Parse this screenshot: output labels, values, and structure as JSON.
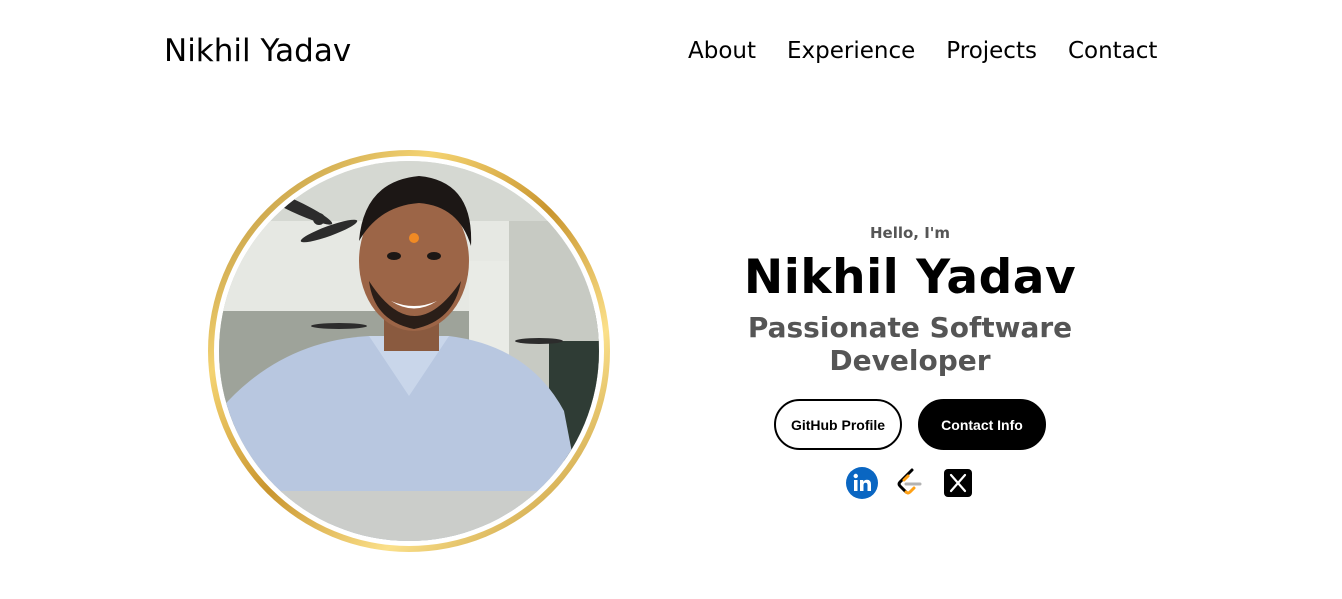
{
  "header": {
    "logo": "Nikhil Yadav",
    "nav": [
      {
        "label": "About"
      },
      {
        "label": "Experience"
      },
      {
        "label": "Projects"
      },
      {
        "label": "Contact"
      }
    ]
  },
  "hero": {
    "greeting": "Hello, I'm",
    "name": "Nikhil Yadav",
    "title": "Passionate Software Developer",
    "buttons": {
      "github": "GitHub Profile",
      "contact": "Contact Info"
    },
    "social_icons": [
      "linkedin-icon",
      "leetcode-icon",
      "x-twitter-icon"
    ]
  },
  "colors": {
    "accent_gold": "#d4a43a",
    "linkedin_blue": "#0a66c2",
    "leetcode_orange": "#ffa116",
    "text_gray": "#555555"
  }
}
